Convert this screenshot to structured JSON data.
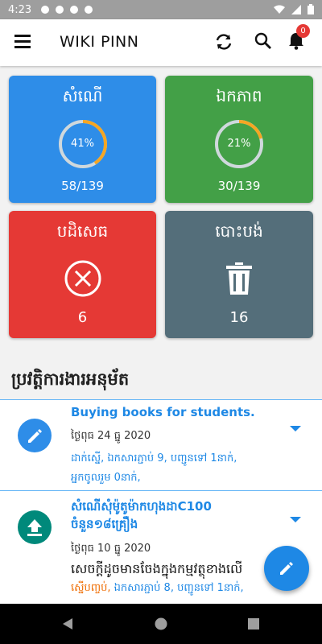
{
  "status": {
    "time": "4:23"
  },
  "app": {
    "title": "WIKI PINN",
    "notification_count": "0"
  },
  "cards": {
    "requests": {
      "title": "សំណើ",
      "percent_label": "41%",
      "percent": 0.41,
      "count": "58/139",
      "color": "#2e8de8"
    },
    "approved": {
      "title": "ឯកភាព",
      "percent_label": "21%",
      "percent": 0.21,
      "count": "30/139",
      "color": "#43a047"
    },
    "rejected": {
      "title": "បដិសេធ",
      "count": "6",
      "color": "#e53935"
    },
    "cancelled": {
      "title": "បោះបង់",
      "count": "16",
      "color": "#546e7a"
    }
  },
  "history": {
    "title": "ប្រវត្តិការងារអនុម័ត",
    "items": [
      {
        "title": "Buying books for students.",
        "date": "ថ្ងៃពុធ 24 ធ្នូ 2020",
        "info1": "ដាក់ស្នើ, ឯកសារភ្ជាប់ 9, បញ្ជូនទៅ 1នាក់,",
        "info2": "អ្នកចូលរួម 0នាក់,",
        "icon": "pencil-icon",
        "avatar_color": "#2e8de8"
      },
      {
        "title": "សំណើសុំម៉ូតូម៉ាកហុងដាC100 ចំនួន១៨គ្រឿង",
        "date": "ថ្ងៃពុធ 10 ធ្នូ 2020",
        "description": "សេចក្ដីដូចមានចែងក្នុងកម្មវត្ថុខាងលើ",
        "status_word": "ស្នើបញ្ចប់,",
        "info_rest": " ឯកសារភ្ជាប់ 8, បញ្ជូនទៅ 1នាក់,",
        "icon": "upload-icon",
        "avatar_color": "#00897b"
      }
    ]
  },
  "colors": {
    "accent": "#1e88e5",
    "orange": "#f5a623",
    "ring_track": "#cfd8dc",
    "status_orange": "#ef6c00"
  }
}
